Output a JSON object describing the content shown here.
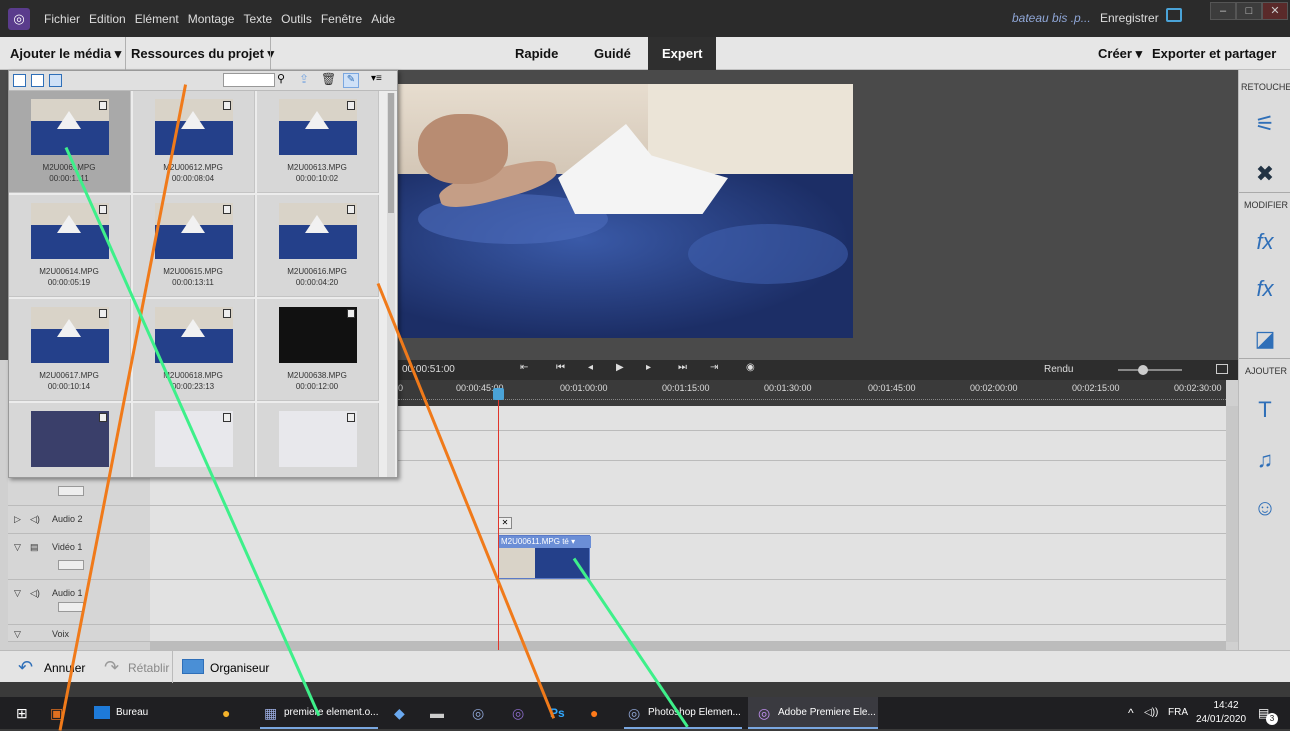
{
  "menubar": {
    "items": [
      "Fichier",
      "Edition",
      "Elément",
      "Montage",
      "Texte",
      "Outils",
      "Fenêtre",
      "Aide"
    ],
    "project_name": "bateau bis .p...",
    "save_label": "Enregistrer",
    "win_min": "–",
    "win_max": "□",
    "win_close": "✕"
  },
  "toolbar": {
    "add_media": "Ajouter le média ▾",
    "project_resources": "Ressources du projet ▾",
    "mode_quick": "Rapide",
    "mode_guided": "Guidé",
    "mode_expert": "Expert",
    "create": "Créer ▾",
    "export": "Exporter et partager"
  },
  "right_panel": {
    "retouche": "RETOUCHE",
    "modifier": "MODIFIER",
    "ajouter": "AJOUTER"
  },
  "assets": [
    {
      "name": "M2U006..MPG",
      "duration": "00:00:1..11"
    },
    {
      "name": "M2U00612.MPG",
      "duration": "00:00:08:04"
    },
    {
      "name": "M2U00613.MPG",
      "duration": "00:00:10:02"
    },
    {
      "name": "M2U00614.MPG",
      "duration": "00:00:05:19"
    },
    {
      "name": "M2U00615.MPG",
      "duration": "00:00:13:11"
    },
    {
      "name": "M2U00616.MPG",
      "duration": "00:00:04:20"
    },
    {
      "name": "M2U00617.MPG",
      "duration": "00:00:10:14"
    },
    {
      "name": "M2U00618.MPG",
      "duration": "00:00:23:13"
    },
    {
      "name": "M2U00638.MPG",
      "duration": "00:00:12:00"
    },
    {
      "name": "",
      "duration": ""
    },
    {
      "name": "",
      "duration": ""
    },
    {
      "name": "",
      "duration": ""
    }
  ],
  "timeline": {
    "current_time": "00:00:51:00",
    "render_label": "Rendu",
    "ruler": [
      "0",
      "00:00:45:00",
      "00:01:00:00",
      "00:01:15:00",
      "00:01:30:00",
      "00:01:45:00",
      "00:02:00:00",
      "00:02:15:00",
      "00:02:30:00"
    ],
    "tracks": {
      "audio2": "Audio 2",
      "video1": "Vidéo 1",
      "audio1": "Audio 1",
      "voice": "Voix"
    },
    "clip_label": "M2U00611.MPG té ▾"
  },
  "bottombar": {
    "undo": "Annuler",
    "redo": "Rétablir",
    "organizer": "Organiseur"
  },
  "taskbar": {
    "desktop": "Bureau",
    "explorer": "premiere element.o...",
    "photoshop": "Photoshop Elemen...",
    "premiere": "Adobe Premiere Ele...",
    "lang": "FRA",
    "volume": "◁))",
    "time": "14:42",
    "date": "24/01/2020",
    "notif": "3"
  }
}
